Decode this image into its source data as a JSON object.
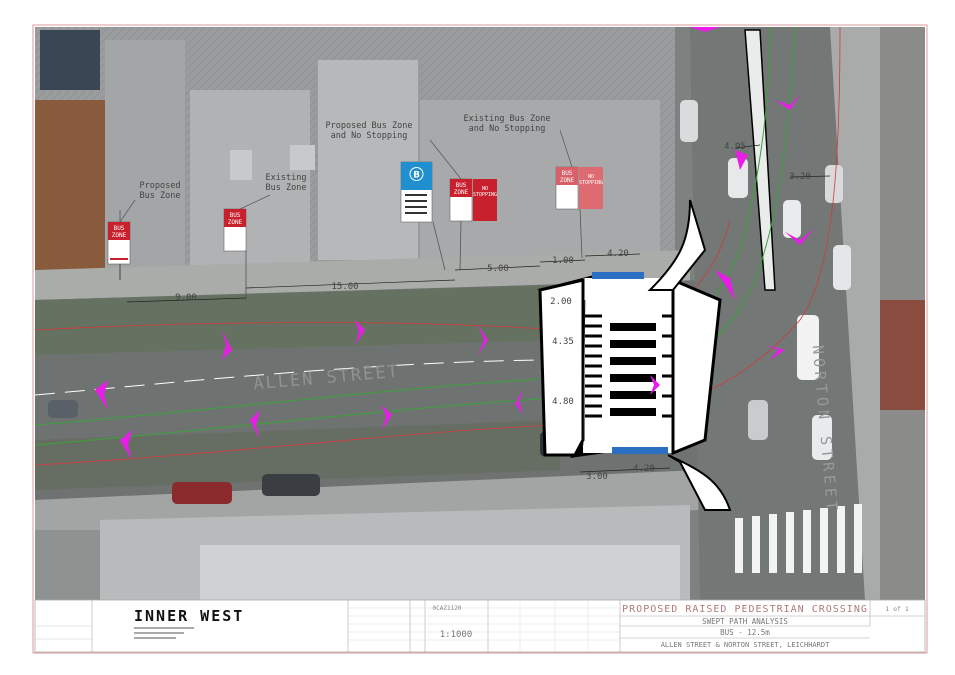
{
  "street_labels": {
    "allen": "ALLEN STREET",
    "norton": "NORTON STREET"
  },
  "sign_labels": {
    "proposed_bus_zone": "Proposed\nBus Zone",
    "existing_bus_zone": "Existing\nBus Zone",
    "proposed_bus_zone_no_stopping": "Proposed Bus Zone\nand No Stopping",
    "existing_bus_zone_no_stopping": "Existing Bus Zone\nand No Stopping"
  },
  "sign_faces": {
    "bus_zone": "BUS\nZONE",
    "no_stopping": "NO\nSTOPPING",
    "bus_stop_letter": "B"
  },
  "dimensions": [
    "9.00",
    "15.00",
    "5.00",
    "1.00",
    "4.20",
    "2.00",
    "4.35",
    "4.80",
    "3.00",
    "4.20",
    "3.20",
    "4.95"
  ],
  "title_block": {
    "logo": "INNER WEST",
    "drawing_no": "0CAZ1120",
    "scale": "1:1000",
    "title": "PROPOSED RAISED PEDESTRIAN CROSSING",
    "subtitle": "SWEPT PATH ANALYSIS",
    "vehicle": "BUS - 12.5m",
    "location": "ALLEN STREET & NORTON STREET, LEICHHARDT",
    "sheet": "1 of 1"
  },
  "colors": {
    "swept_path_arrow": "#e81ee8",
    "bus_zone_red": "#c8202c",
    "bus_stop_blue": "#1f8fd0",
    "crossing_blue": "#2a6fc2"
  }
}
